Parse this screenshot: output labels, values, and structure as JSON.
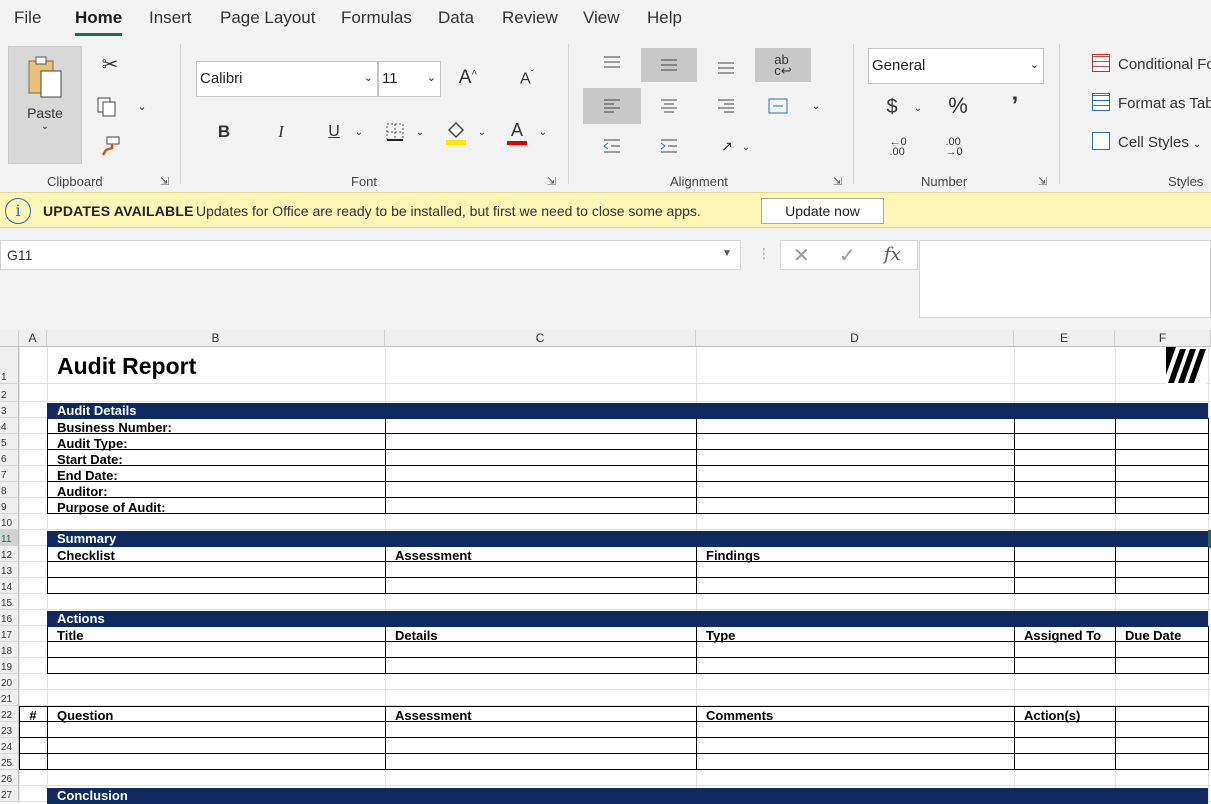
{
  "menu": {
    "tabs": [
      "File",
      "Home",
      "Insert",
      "Page Layout",
      "Formulas",
      "Data",
      "Review",
      "View",
      "Help"
    ],
    "active": "Home"
  },
  "ribbon": {
    "clipboard": {
      "paste_label": "Paste",
      "group_label": "Clipboard"
    },
    "font": {
      "family": "Calibri",
      "size": "11",
      "group_label": "Font"
    },
    "alignment": {
      "group_label": "Alignment"
    },
    "number": {
      "format": "General",
      "group_label": "Number"
    },
    "styles": {
      "conditional": "Conditional Fo",
      "format_table": "Format as Tab",
      "cell_styles": "Cell Styles",
      "group_label": "Styles"
    }
  },
  "update_bar": {
    "title": "UPDATES AVAILABLE",
    "message": "Updates for Office are ready to be installed, but first we need to close some apps.",
    "button": "Update now"
  },
  "formula_bar": {
    "name_box": "G11",
    "formula": ""
  },
  "columns": [
    "A",
    "B",
    "C",
    "D",
    "E",
    "F"
  ],
  "rows": [
    "1",
    "2",
    "3",
    "4",
    "5",
    "6",
    "7",
    "8",
    "9",
    "10",
    "11",
    "12",
    "13",
    "14",
    "15",
    "16",
    "17",
    "18",
    "19",
    "20",
    "21",
    "22",
    "23",
    "24",
    "25",
    "26",
    "27"
  ],
  "selected_row": "11",
  "sheet": {
    "title": "Audit Report",
    "audit_details": {
      "header": "Audit Details",
      "fields": [
        "Business Number:",
        "Audit Type:",
        "Start Date:",
        "End Date:",
        "Auditor:",
        "Purpose of Audit:"
      ]
    },
    "summary": {
      "header": "Summary",
      "columns": [
        "Checklist",
        "Assessment",
        "Findings"
      ]
    },
    "actions": {
      "header": "Actions",
      "columns": [
        "Title",
        "Details",
        "Type",
        "Assigned To",
        "Due Date"
      ]
    },
    "questions": {
      "columns": [
        "#",
        "Question",
        "Assessment",
        "Comments",
        "Action(s)"
      ]
    },
    "conclusion": {
      "header": "Conclusion"
    }
  }
}
